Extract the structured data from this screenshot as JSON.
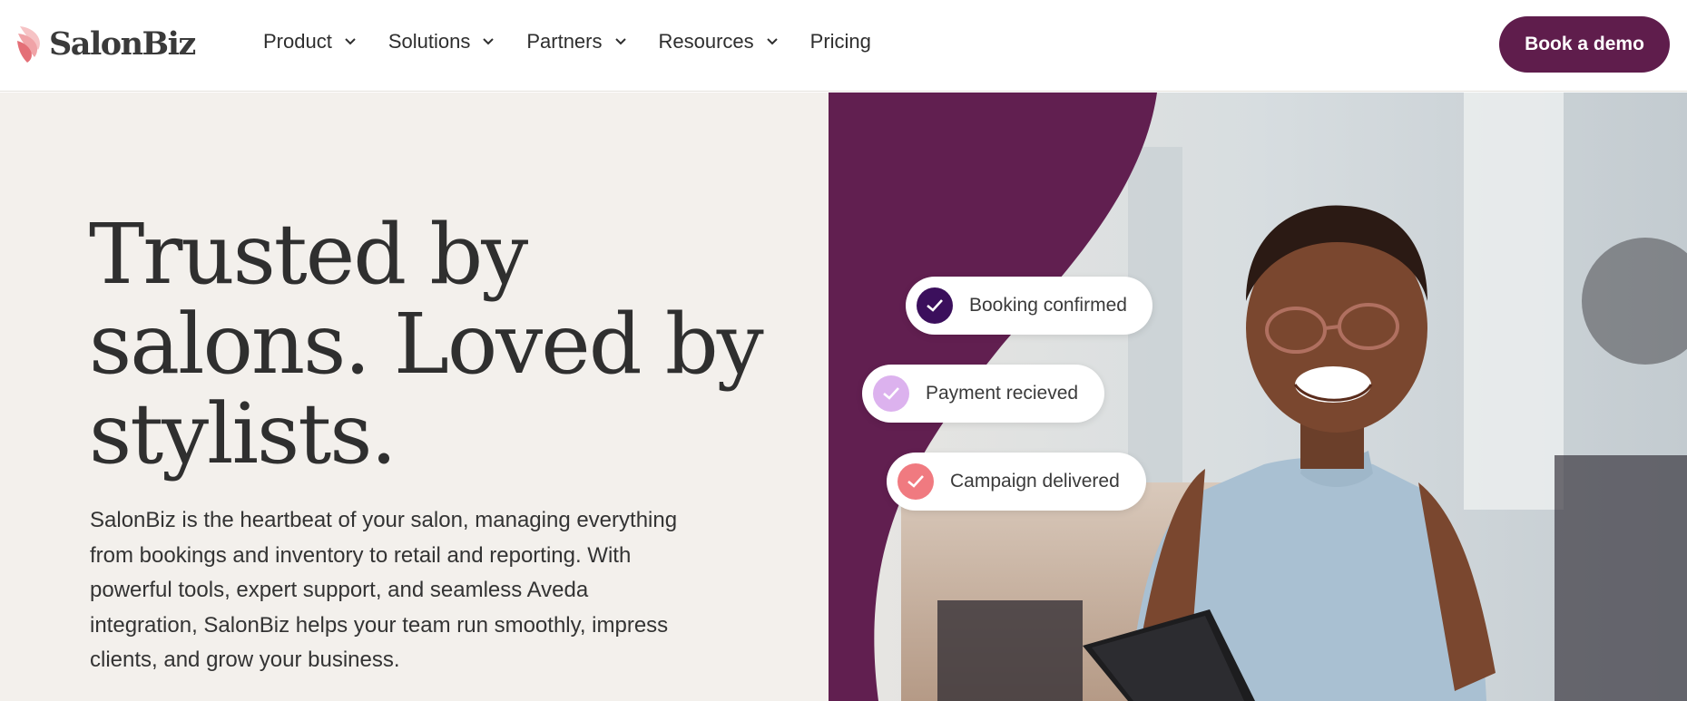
{
  "brand": {
    "name": "SalonBiz",
    "accent": "#5f1d4c",
    "logo_colors": [
      "#f0a3a7",
      "#e46f77"
    ]
  },
  "nav": {
    "items": [
      {
        "label": "Product",
        "has_dropdown": true
      },
      {
        "label": "Solutions",
        "has_dropdown": true
      },
      {
        "label": "Partners",
        "has_dropdown": true
      },
      {
        "label": "Resources",
        "has_dropdown": true
      },
      {
        "label": "Pricing",
        "has_dropdown": false
      }
    ],
    "cta_label": "Book a demo"
  },
  "hero": {
    "headline_lines": [
      "Trusted by",
      "salons. Loved by",
      "stylists."
    ],
    "description_lines": [
      "SalonBiz is the heartbeat of your salon, managing everything",
      "from bookings and inventory to retail and reporting. With",
      "powerful tools, expert support, and seamless Aveda",
      "integration, SalonBiz helps your team run smoothly, impress",
      "clients, and grow your business."
    ],
    "notifications": [
      {
        "label": "Booking confirmed",
        "icon": "check-icon",
        "color": "#3b0f5c"
      },
      {
        "label": "Payment recieved",
        "icon": "check-icon",
        "color": "#dcb2ee"
      },
      {
        "label": "Campaign delivered",
        "icon": "check-icon",
        "color": "#f07a80"
      }
    ]
  },
  "colors": {
    "hero_background": "#f3f0ec",
    "plum_panel": "#611f50",
    "text": "#2f2f2f"
  }
}
